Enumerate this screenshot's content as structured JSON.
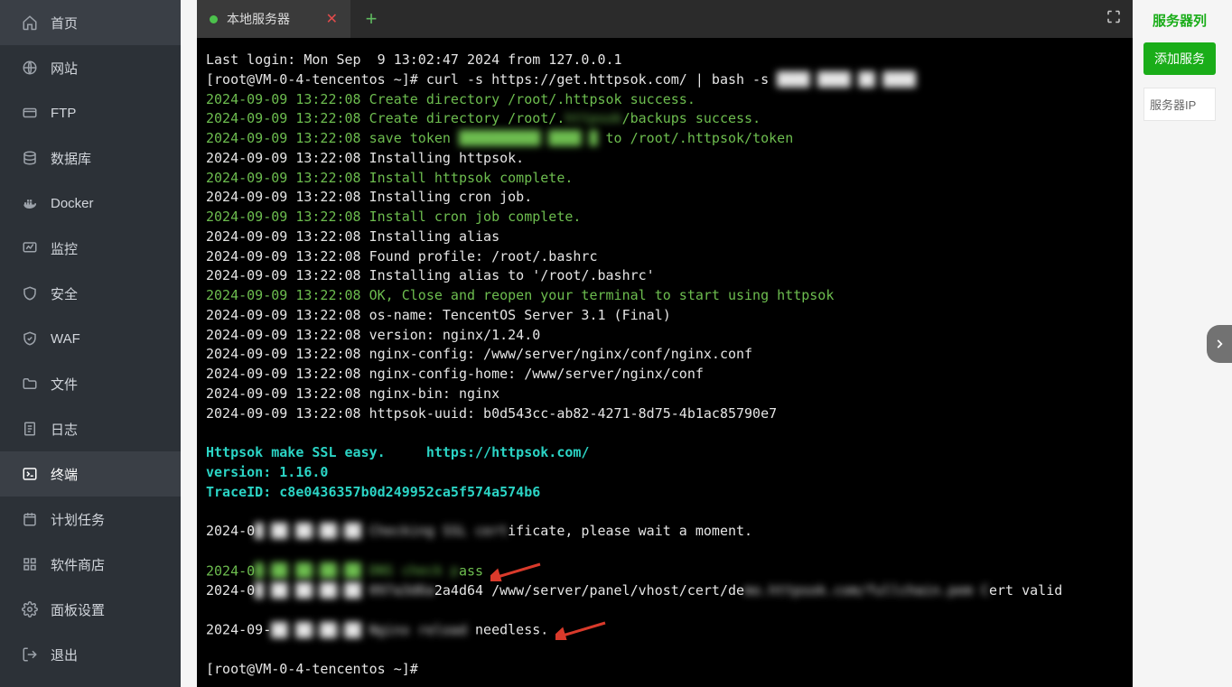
{
  "sidebar": {
    "items": [
      {
        "icon": "home",
        "label": "首页"
      },
      {
        "icon": "globe",
        "label": "网站"
      },
      {
        "icon": "ftp",
        "label": "FTP"
      },
      {
        "icon": "database",
        "label": "数据库"
      },
      {
        "icon": "docker",
        "label": "Docker"
      },
      {
        "icon": "monitor",
        "label": "监控"
      },
      {
        "icon": "shield",
        "label": "安全"
      },
      {
        "icon": "waf",
        "label": "WAF"
      },
      {
        "icon": "folder",
        "label": "文件"
      },
      {
        "icon": "log",
        "label": "日志"
      },
      {
        "icon": "terminal",
        "label": "终端",
        "active": true
      },
      {
        "icon": "schedule",
        "label": "计划任务"
      },
      {
        "icon": "store",
        "label": "软件商店"
      },
      {
        "icon": "settings",
        "label": "面板设置"
      },
      {
        "icon": "logout",
        "label": "退出"
      }
    ]
  },
  "tabs": {
    "items": [
      {
        "label": "本地服务器"
      }
    ]
  },
  "rightpanel": {
    "header_link": "服务器列",
    "add_button": "添加服务",
    "box_label": "服务器IP"
  },
  "terminal": {
    "lines": [
      {
        "cls": "c-white",
        "text": "Last login: Mon Sep  9 13:02:47 2024 from 127.0.0.1"
      },
      {
        "cls": "c-white",
        "segments": [
          {
            "t": "[root@VM-0-4-tencentos ~]# curl -s https://get.httpsok.com/ | bash -s "
          },
          {
            "t": "████ ████ ██ ████",
            "blur": true
          }
        ]
      },
      {
        "cls": "c-green",
        "text": "2024-09-09 13:22:08 Create directory /root/.httpsok success."
      },
      {
        "cls": "c-green",
        "segments": [
          {
            "t": "2024-09-09 13:22:08 Create directory /root/."
          },
          {
            "t": "httpsok",
            "blur": true
          },
          {
            "t": "/backups success."
          }
        ]
      },
      {
        "cls": "c-green",
        "segments": [
          {
            "t": "2024-09-09 13:22:08 save token "
          },
          {
            "t": "██████████ ████ █",
            "blur": true
          },
          {
            "t": " to /root/.httpsok/token"
          }
        ]
      },
      {
        "cls": "c-white",
        "text": "2024-09-09 13:22:08 Installing httpsok."
      },
      {
        "cls": "c-green",
        "text": "2024-09-09 13:22:08 Install httpsok complete."
      },
      {
        "cls": "c-white",
        "text": "2024-09-09 13:22:08 Installing cron job."
      },
      {
        "cls": "c-green",
        "text": "2024-09-09 13:22:08 Install cron job complete."
      },
      {
        "cls": "c-white",
        "text": "2024-09-09 13:22:08 Installing alias"
      },
      {
        "cls": "c-white",
        "text": "2024-09-09 13:22:08 Found profile: /root/.bashrc"
      },
      {
        "cls": "c-white",
        "text": "2024-09-09 13:22:08 Installing alias to '/root/.bashrc'"
      },
      {
        "cls": "c-green",
        "text": "2024-09-09 13:22:08 OK, Close and reopen your terminal to start using httpsok"
      },
      {
        "cls": "c-white",
        "text": "2024-09-09 13:22:08 os-name: TencentOS Server 3.1 (Final)"
      },
      {
        "cls": "c-white",
        "text": "2024-09-09 13:22:08 version: nginx/1.24.0"
      },
      {
        "cls": "c-white",
        "text": "2024-09-09 13:22:08 nginx-config: /www/server/nginx/conf/nginx.conf"
      },
      {
        "cls": "c-white",
        "text": "2024-09-09 13:22:08 nginx-config-home: /www/server/nginx/conf"
      },
      {
        "cls": "c-white",
        "text": "2024-09-09 13:22:08 nginx-bin: nginx"
      },
      {
        "cls": "c-white",
        "text": "2024-09-09 13:22:08 httpsok-uuid: b0d543cc-ab82-4271-8d75-4b1ac85790e7"
      },
      {
        "cls": "",
        "text": " "
      },
      {
        "cls": "c-cyan",
        "text": "Httpsok make SSL easy.     https://httpsok.com/"
      },
      {
        "cls": "c-cyan",
        "text": "version: 1.16.0"
      },
      {
        "cls": "c-cyan",
        "text": "TraceID: c8e0436357b0d249952ca5f574a574b6"
      },
      {
        "cls": "",
        "text": " "
      },
      {
        "cls": "c-white",
        "segments": [
          {
            "t": "2024-0"
          },
          {
            "t": "█ ██ ██:██:██ Checking SSL cert",
            "blur": true
          },
          {
            "t": "ificate, please wait a moment."
          }
        ]
      },
      {
        "cls": "",
        "text": " "
      },
      {
        "cls": "c-green",
        "segments": [
          {
            "t": "2024-0"
          },
          {
            "t": "█-██ ██:██:██ DNS check p",
            "blur": true
          },
          {
            "t": "ass"
          }
        ],
        "arrow": true
      },
      {
        "cls": "c-white",
        "segments": [
          {
            "t": "2024-0"
          },
          {
            "t": "█ ██ ██:██:██ 097a3d6a",
            "blur": true
          },
          {
            "t": "2a4d64 /www/server/panel/vhost/cert/de"
          },
          {
            "t": "mo.httpsok.com/fullchain.pem C",
            "blur": true
          },
          {
            "t": "ert valid"
          }
        ]
      },
      {
        "cls": "",
        "text": " "
      },
      {
        "cls": "c-white",
        "segments": [
          {
            "t": "2024-09-"
          },
          {
            "t": "██ ██:██:██ Nginx reload",
            "blur": true
          },
          {
            "t": " needless."
          }
        ],
        "arrow": true
      },
      {
        "cls": "",
        "text": " "
      },
      {
        "cls": "c-white",
        "text": "[root@VM-0-4-tencentos ~]#"
      }
    ]
  }
}
